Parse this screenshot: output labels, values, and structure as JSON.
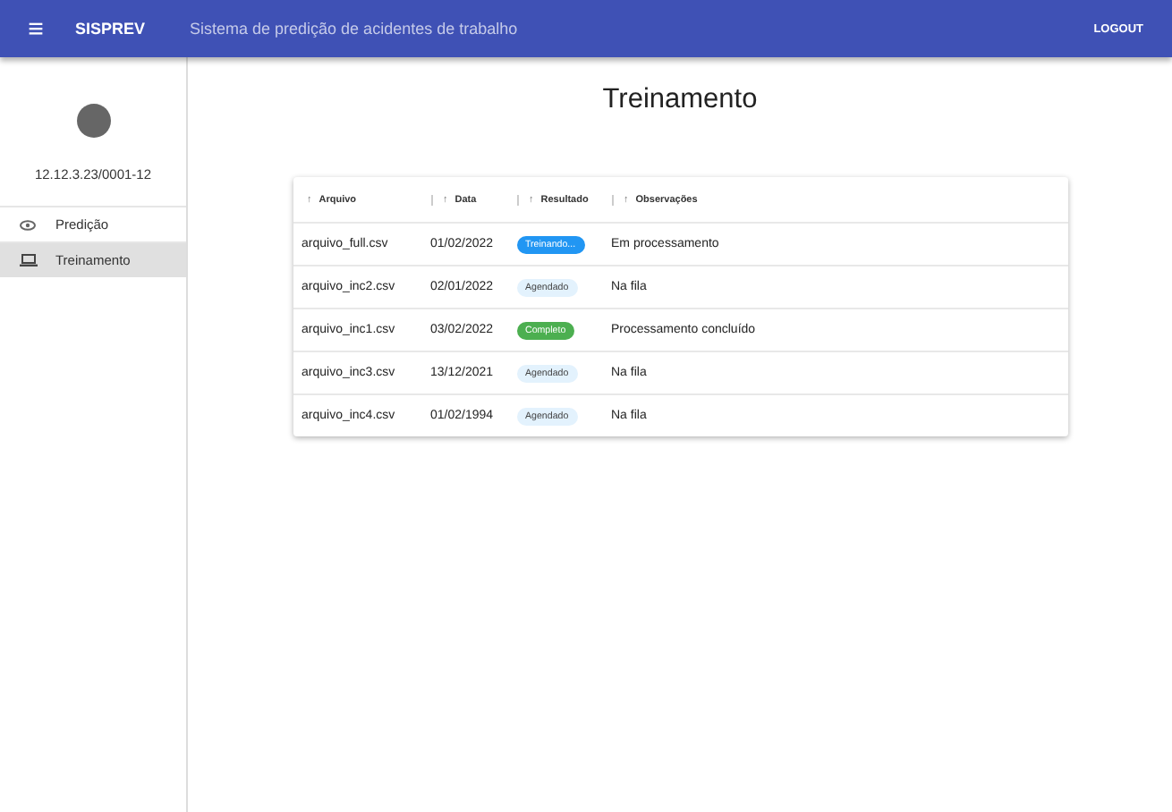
{
  "app_bar": {
    "menu_icon": "≡",
    "title": "SISPREV",
    "subtitle": "Sistema de predição de acidentes de trabalho",
    "logout": "LOGOUT"
  },
  "sidebar": {
    "account_id": "12.12.3.23/0001-12",
    "items": [
      {
        "label": "Predição",
        "kind": "prediction",
        "selected": false
      },
      {
        "label": "Treinamento",
        "kind": "training",
        "selected": true
      }
    ]
  },
  "page_title": "Treinamento",
  "table": {
    "columns": [
      "Arquivo",
      "Data",
      "Resultado",
      "Observações"
    ],
    "sort_icon": "↑",
    "rows": [
      {
        "file": "arquivo_full.csv",
        "date": "01/02/2022",
        "status": {
          "label": "Treinando...",
          "kind": "running"
        },
        "notes": "Em processamento"
      },
      {
        "file": "arquivo_inc2.csv",
        "date": "02/01/2022",
        "status": {
          "label": "Agendado",
          "kind": "scheduled"
        },
        "notes": "Na fila"
      },
      {
        "file": "arquivo_inc1.csv",
        "date": "03/02/2022",
        "status": {
          "label": "Completo",
          "kind": "done"
        },
        "notes": "Processamento concluído"
      },
      {
        "file": "arquivo_inc3.csv",
        "date": "13/12/2021",
        "status": {
          "label": "Agendado",
          "kind": "scheduled"
        },
        "notes": "Na fila"
      },
      {
        "file": "arquivo_inc4.csv",
        "date": "01/02/1994",
        "status": {
          "label": "Agendado",
          "kind": "scheduled"
        },
        "notes": "Na fila"
      }
    ]
  }
}
